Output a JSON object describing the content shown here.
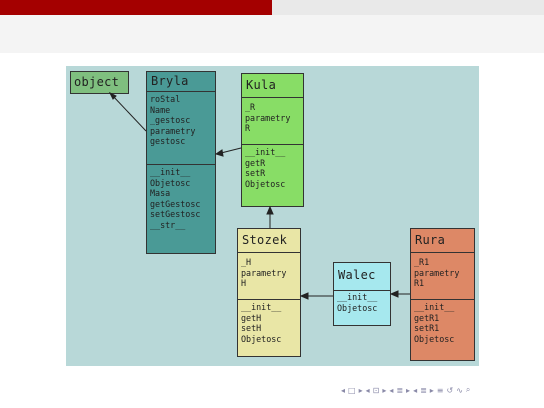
{
  "classes": {
    "object": {
      "name": "object",
      "color": "#7fbf7f"
    },
    "bryla": {
      "name": "Bryla",
      "color": "#4a9a96",
      "attributes": [
        "roStal",
        "Name",
        "_gestosc",
        "parametry",
        "gestosc"
      ],
      "methods": [
        "__init__",
        "Objetosc",
        "Masa",
        "getGestosc",
        "setGestosc",
        "__str__"
      ]
    },
    "kula": {
      "name": "Kula",
      "color": "#88dd66",
      "attributes": [
        "_R",
        "parametry",
        "R"
      ],
      "methods": [
        "__init__",
        "getR",
        "setR",
        "Objetosc"
      ]
    },
    "stozek": {
      "name": "Stozek",
      "color": "#e9e6a6",
      "attributes": [
        "_H",
        "parametry",
        "H"
      ],
      "methods": [
        "__init__",
        "getH",
        "setH",
        "Objetosc"
      ]
    },
    "walec": {
      "name": "Walec",
      "color": "#a6e8ee",
      "attributes": [],
      "methods": [
        "__init__",
        "Objetosc"
      ]
    },
    "rura": {
      "name": "Rura",
      "color": "#dd8866",
      "attributes": [
        "_R1",
        "parametry",
        "R1"
      ],
      "methods": [
        "__init__",
        "getR1",
        "setR1",
        "Objetosc"
      ]
    }
  },
  "nav_symbols": [
    "◂",
    "□",
    "▸",
    "◂",
    "⊡",
    "▸",
    "◂",
    "≣",
    "▸",
    "◂",
    "≣",
    "▸",
    "≡",
    "↺",
    "∿",
    "⌕"
  ]
}
